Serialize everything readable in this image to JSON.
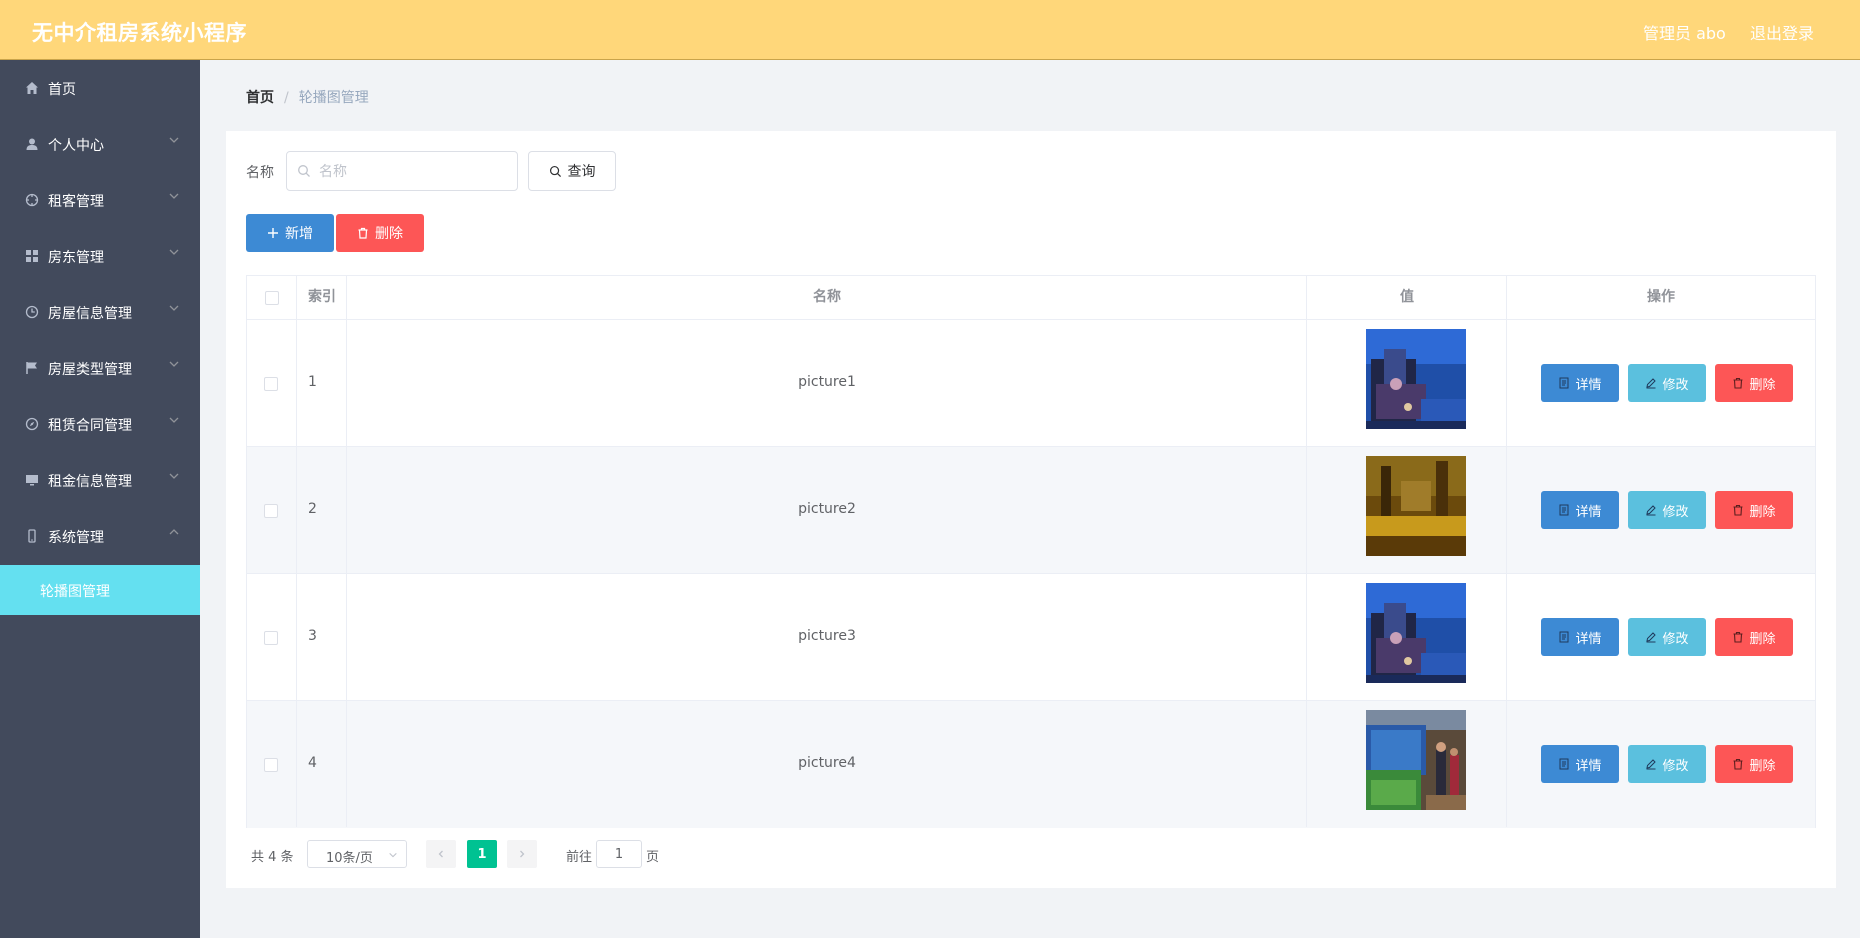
{
  "header": {
    "title": "无中介租房系统小程序",
    "user": "管理员 abo",
    "logout": "退出登录"
  },
  "sidebar": {
    "items": [
      {
        "label": "首页",
        "icon": "home-icon",
        "has_arrow": false
      },
      {
        "label": "个人中心",
        "icon": "user-icon",
        "has_arrow": true
      },
      {
        "label": "租客管理",
        "icon": "target-icon",
        "has_arrow": true
      },
      {
        "label": "房东管理",
        "icon": "grid-icon",
        "has_arrow": true
      },
      {
        "label": "房屋信息管理",
        "icon": "clock-icon",
        "has_arrow": true
      },
      {
        "label": "房屋类型管理",
        "icon": "flag-icon",
        "has_arrow": true
      },
      {
        "label": "租赁合同管理",
        "icon": "compass-icon",
        "has_arrow": true
      },
      {
        "label": "租金信息管理",
        "icon": "monitor-icon",
        "has_arrow": true
      },
      {
        "label": "系统管理",
        "icon": "phone-icon",
        "has_arrow": true,
        "expanded": true
      }
    ],
    "active_sub": "轮播图管理"
  },
  "breadcrumb": {
    "home": "首页",
    "separator": "/",
    "current": "轮播图管理"
  },
  "search": {
    "label": "名称",
    "placeholder": "名称",
    "button": "查询"
  },
  "actions": {
    "add": "新增",
    "delete": "删除"
  },
  "table": {
    "headers": {
      "index": "索引",
      "name": "名称",
      "value": "值",
      "ops": "操作"
    },
    "rows": [
      {
        "index": "1",
        "name": "picture1",
        "image": "night-city-blue"
      },
      {
        "index": "2",
        "name": "picture2",
        "image": "night-street-gold"
      },
      {
        "index": "3",
        "name": "picture3",
        "image": "night-city-blue"
      },
      {
        "index": "4",
        "name": "picture4",
        "image": "aquarium-crowd"
      }
    ],
    "row_buttons": {
      "detail": "详情",
      "edit": "修改",
      "delete": "删除"
    }
  },
  "pagination": {
    "total": "共 4 条",
    "page_size": "10条/页",
    "current": "1",
    "goto": "前往",
    "goto_value": "1",
    "page_suffix": "页"
  },
  "colors": {
    "header": "#ffd77a",
    "sidebar": "#424a5c",
    "active_sub": "#64e0f0",
    "primary": "#3d8ad4",
    "info": "#5bc0de",
    "danger": "#fd5656",
    "page_active": "#00c292"
  }
}
